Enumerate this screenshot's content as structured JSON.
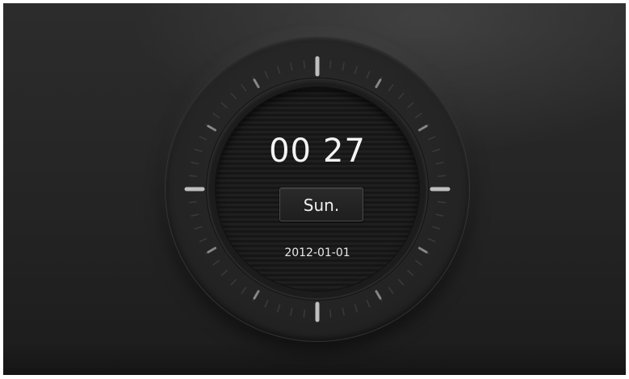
{
  "clock": {
    "hours": "00",
    "minutes": "27",
    "day": "Sun.",
    "date": "2012-01-01"
  },
  "colors": {
    "background": "#262626",
    "text": "#f4f4f4",
    "tick": "#cfcfcf"
  }
}
